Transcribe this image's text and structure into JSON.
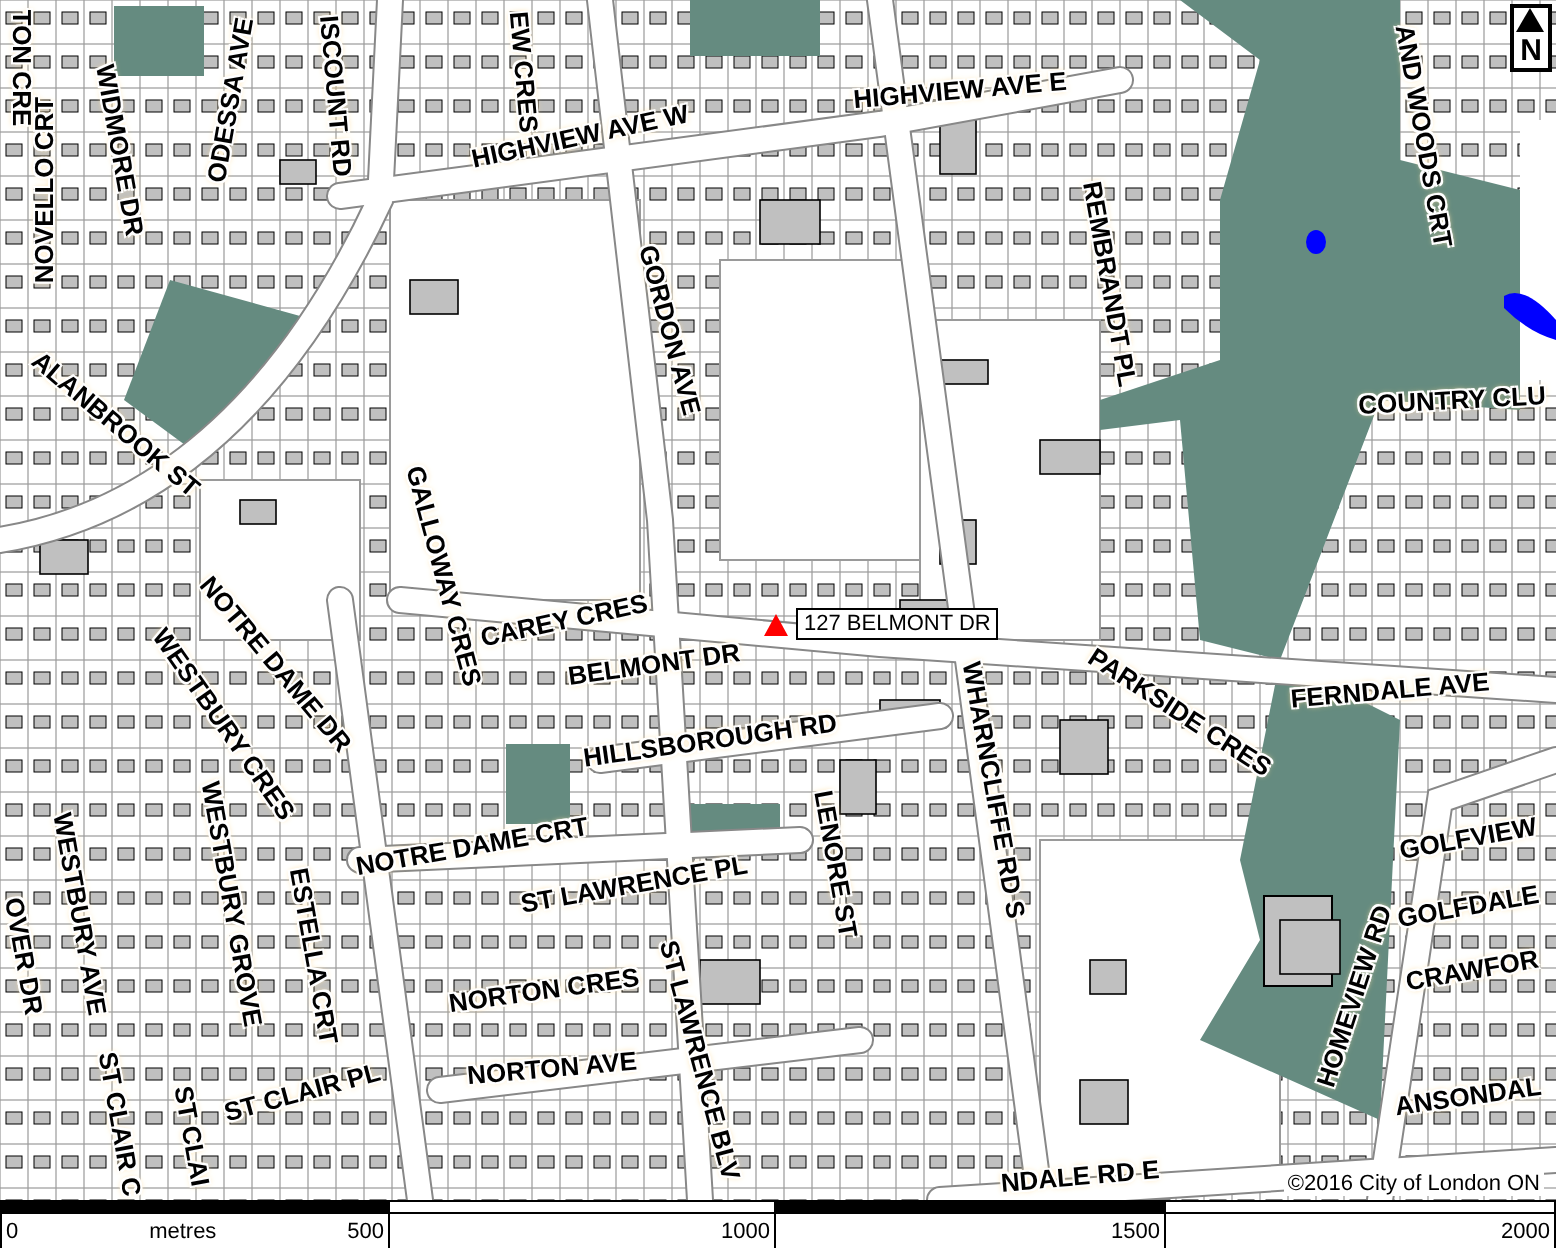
{
  "map": {
    "street_labels": [
      {
        "text": "TON CRE"
      },
      {
        "text": "NOVELLO CRT"
      },
      {
        "text": "WIDMORE DR"
      },
      {
        "text": "ODESSA AVE"
      },
      {
        "text": "ISCOUNT RD"
      },
      {
        "text": "EW CRES"
      },
      {
        "text": "HIGHVIEW AVE W"
      },
      {
        "text": "HIGHVIEW AVE E"
      },
      {
        "text": "REMBRANDT PL"
      },
      {
        "text": "AND WOODS CRT"
      },
      {
        "text": "COUNTRY CLU"
      },
      {
        "text": "GORDON AVE"
      },
      {
        "text": "ALANBROOK ST"
      },
      {
        "text": "GALLOWAY CRES"
      },
      {
        "text": "CAREY CRES"
      },
      {
        "text": "NOTRE DAME DR"
      },
      {
        "text": "WESTBURY CRES"
      },
      {
        "text": "BELMONT DR"
      },
      {
        "text": "HILLSBOROUGH RD"
      },
      {
        "text": "LENORE ST"
      },
      {
        "text": "WHARNCLIFFE RD S"
      },
      {
        "text": "PARKSIDE CRES"
      },
      {
        "text": "FERNDALE AVE"
      },
      {
        "text": "GOLFVIEW"
      },
      {
        "text": "GOLFDALE"
      },
      {
        "text": "CRAWFOR"
      },
      {
        "text": "ANSONDAL"
      },
      {
        "text": "HOMEVIEW RD"
      },
      {
        "text": "NDALE RD E"
      },
      {
        "text": "NOTRE DAME CRT"
      },
      {
        "text": "ST LAWRENCE PL"
      },
      {
        "text": "NORTON CRES"
      },
      {
        "text": "NORTON AVE"
      },
      {
        "text": "ST LAWRENCE BLV"
      },
      {
        "text": "ESTELLA CRT"
      },
      {
        "text": "WESTBURY GROVE"
      },
      {
        "text": "WESTBURY AVE"
      },
      {
        "text": "ST CLAIR PL"
      },
      {
        "text": "ST CLAIR C"
      },
      {
        "text": "ST CLAI"
      },
      {
        "text": "OVER DR"
      }
    ],
    "marker": {
      "label": "127 BELMONT DR"
    },
    "north_arrow": "N",
    "copyright": "©2016 City of London ON"
  },
  "scale_bar": {
    "unit": "metres",
    "ticks": [
      "0",
      "500",
      "1000",
      "1500",
      "2000"
    ]
  }
}
